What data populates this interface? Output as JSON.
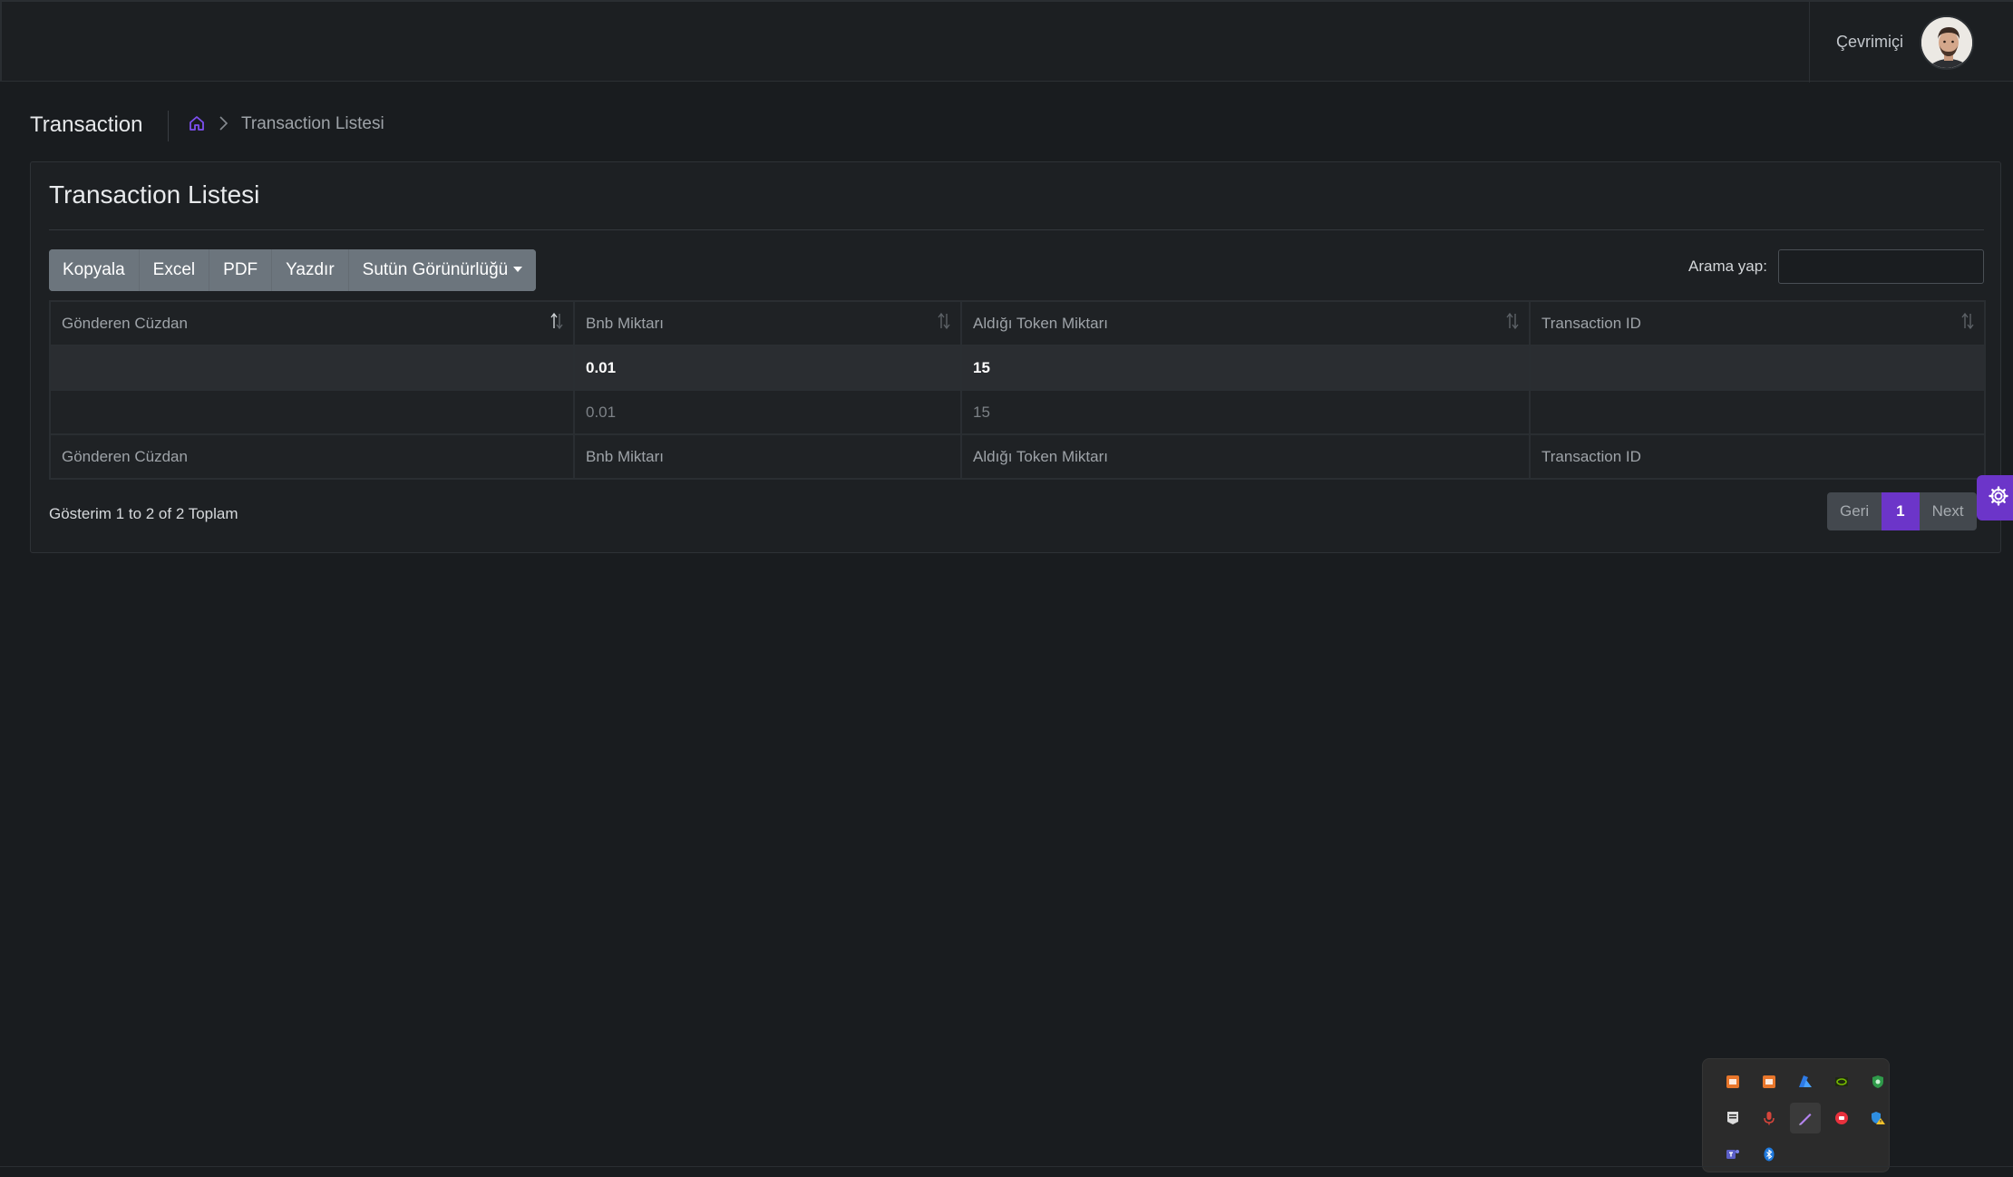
{
  "header": {
    "status": "Çevrimiçi"
  },
  "breadcrumb": {
    "page_title": "Transaction",
    "current": "Transaction Listesi"
  },
  "card": {
    "title": "Transaction Listesi",
    "buttons": {
      "copy": "Kopyala",
      "excel": "Excel",
      "pdf": "PDF",
      "print": "Yazdır",
      "column_visibility": "Sutün Görünürlüğü"
    },
    "search": {
      "label": "Arama yap:",
      "value": ""
    },
    "table": {
      "columns": [
        "Gönderen Cüzdan",
        "Bnb Miktarı",
        "Aldığı Token Miktarı",
        "Transaction ID"
      ],
      "rows": [
        [
          "",
          "0.01",
          "15",
          ""
        ],
        [
          "",
          "0.01",
          "15",
          ""
        ]
      ]
    },
    "info": "Gösterim 1 to 2 of 2 Toplam",
    "pagination": {
      "prev": "Geri",
      "current": "1",
      "next": "Next"
    }
  },
  "tray": {
    "icons": [
      "app-orange-icon",
      "app-orange-icon-2",
      "azure-icon",
      "nvidia-icon",
      "security-shield-icon",
      "epic-games-icon",
      "mic-icon",
      "pen-icon",
      "record-icon",
      "defender-warning-icon",
      "teams-icon",
      "bluetooth-icon"
    ]
  },
  "colors": {
    "accent": "#6c35c9",
    "background": "#191c1f",
    "card": "#1d2023",
    "button": "#6c757d"
  }
}
